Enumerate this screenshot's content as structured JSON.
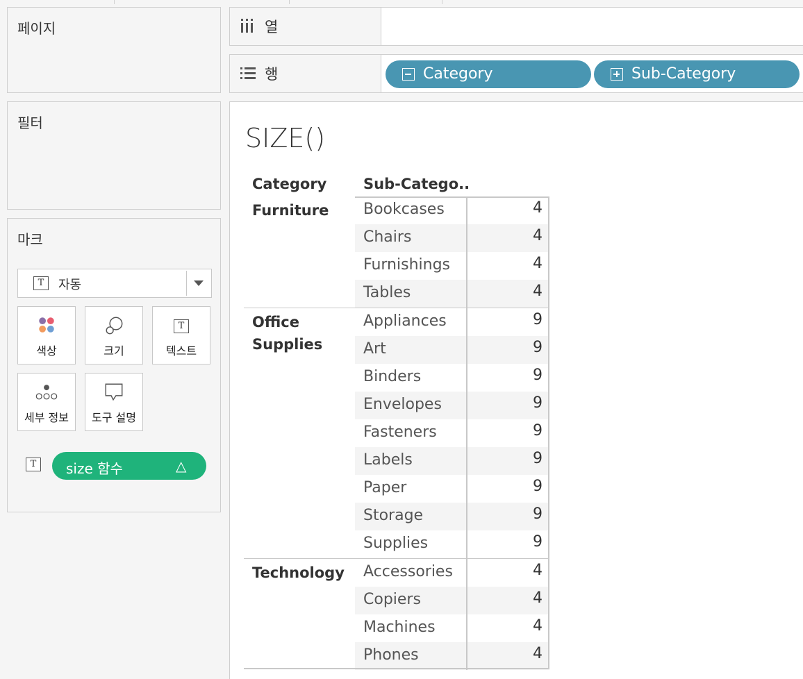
{
  "left_panels": {
    "pages_title": "페이지",
    "filters_title": "필터",
    "marks_title": "마크",
    "mark_type": "자동",
    "mark_buttons": [
      {
        "label": "색상",
        "icon": "color-dots-icon"
      },
      {
        "label": "크기",
        "icon": "size-circles-icon"
      },
      {
        "label": "텍스트",
        "icon": "text-t-icon"
      },
      {
        "label": "세부 정보",
        "icon": "detail-dots-icon"
      },
      {
        "label": "도구 설명",
        "icon": "tooltip-bubble-icon"
      }
    ],
    "mark_field": {
      "label": "size 함수",
      "icon": "delta-icon",
      "encoding_icon": "text-t-icon"
    }
  },
  "shelves": {
    "columns_label": "열",
    "rows_label": "행",
    "row_pills": [
      {
        "label": "Category",
        "toggle": "collapse"
      },
      {
        "label": "Sub-Category",
        "toggle": "expand"
      }
    ]
  },
  "view": {
    "title": "SIZE()",
    "headers": {
      "category": "Category",
      "subcategory": "Sub-Catego.."
    },
    "groups": [
      {
        "name": "Furniture",
        "rows": [
          {
            "sub": "Bookcases",
            "value": "4"
          },
          {
            "sub": "Chairs",
            "value": "4"
          },
          {
            "sub": "Furnishings",
            "value": "4"
          },
          {
            "sub": "Tables",
            "value": "4"
          }
        ]
      },
      {
        "name": "Office Supplies",
        "rows": [
          {
            "sub": "Appliances",
            "value": "9"
          },
          {
            "sub": "Art",
            "value": "9"
          },
          {
            "sub": "Binders",
            "value": "9"
          },
          {
            "sub": "Envelopes",
            "value": "9"
          },
          {
            "sub": "Fasteners",
            "value": "9"
          },
          {
            "sub": "Labels",
            "value": "9"
          },
          {
            "sub": "Paper",
            "value": "9"
          },
          {
            "sub": "Storage",
            "value": "9"
          },
          {
            "sub": "Supplies",
            "value": "9"
          }
        ]
      },
      {
        "name": "Technology",
        "rows": [
          {
            "sub": "Accessories",
            "value": "4"
          },
          {
            "sub": "Copiers",
            "value": "4"
          },
          {
            "sub": "Machines",
            "value": "4"
          },
          {
            "sub": "Phones",
            "value": "4"
          }
        ]
      }
    ]
  },
  "colors": {
    "pill_blue": "#4996b2",
    "pill_green": "#1fb37b",
    "row_alt": "#f4f4f4"
  }
}
